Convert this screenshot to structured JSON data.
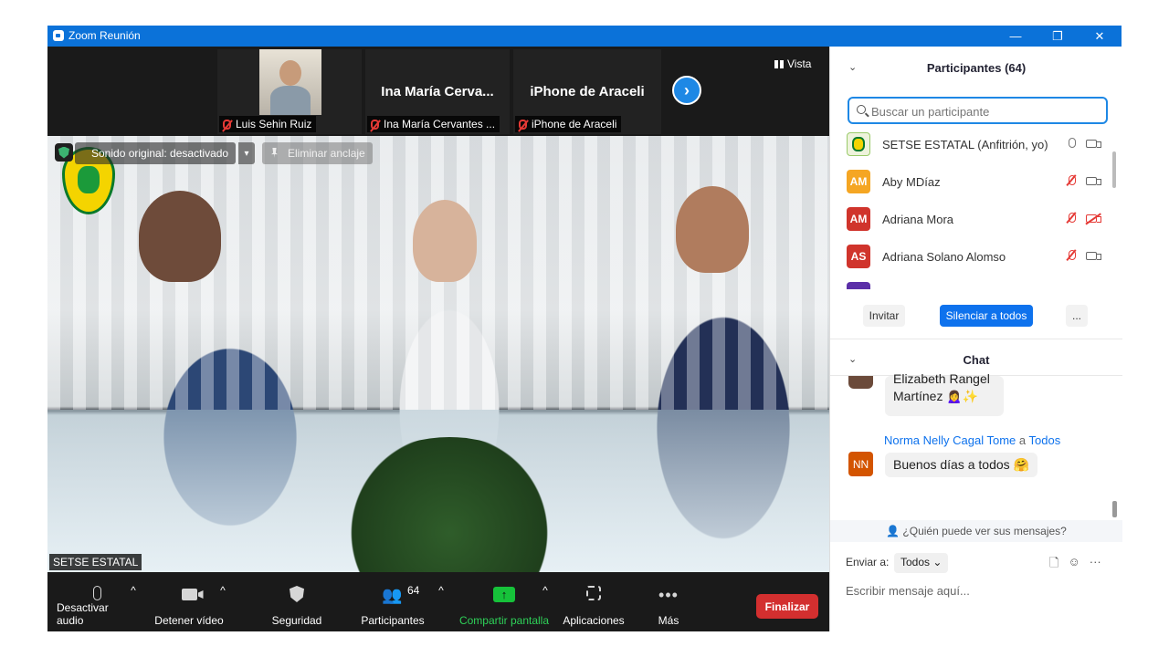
{
  "window": {
    "title": "Zoom Reunión",
    "minimize": "—",
    "restore": "❐",
    "close": "✕"
  },
  "strip": {
    "tiles": [
      {
        "label": "Luis Sehin Ruiz"
      },
      {
        "name": "Ina María Cerva...",
        "label": "Ina María Cervantes ..."
      },
      {
        "name": "iPhone de Araceli",
        "label": "iPhone de Araceli"
      }
    ],
    "view_label": "Vista",
    "next_arrow": "›"
  },
  "video": {
    "original_sound": "Sonido original: desactivado",
    "unpin": "Eliminar anclaje",
    "speaker_label": "SETSE ESTATAL"
  },
  "toolbar": {
    "mute": "Desactivar audio",
    "stop_video": "Detener vídeo",
    "security": "Seguridad",
    "participants": "Participantes",
    "participants_count": "64",
    "share": "Compartir pantalla",
    "apps": "Aplicaciones",
    "more": "Más",
    "end": "Finalizar",
    "caret": "^"
  },
  "participants_panel": {
    "title": "Participantes (64)",
    "search_placeholder": "Buscar un participante",
    "rows": [
      {
        "initials": "",
        "name": "SETSE ESTATAL (Anfitrión, yo)",
        "color": "#e8f0d0"
      },
      {
        "initials": "AM",
        "name": "Aby MDíaz",
        "color": "#f5a623"
      },
      {
        "initials": "AM",
        "name": "Adriana Mora",
        "color": "#d0342c"
      },
      {
        "initials": "AS",
        "name": "Adriana Solano Alomso",
        "color": "#d0342c"
      }
    ],
    "invite": "Invitar",
    "mute_all": "Silenciar a todos",
    "more": "..."
  },
  "chat": {
    "title": "Chat",
    "msg1_line1": "Elizabeth Rangel",
    "msg1_line2": "Martínez 🙍‍♀️✨",
    "sender_name": "Norma Nelly Cagal Tome",
    "sender_to_word": "a",
    "sender_to": "Todos",
    "sender_initials": "NN",
    "sender_color": "#d35400",
    "msg2": "Buenos días a todos 🤗",
    "who_sees": "¿Quién puede ver sus mensajes?",
    "send_to_label": "Enviar a:",
    "send_to_value": "Todos",
    "input_placeholder": "Escribir mensaje aquí..."
  }
}
